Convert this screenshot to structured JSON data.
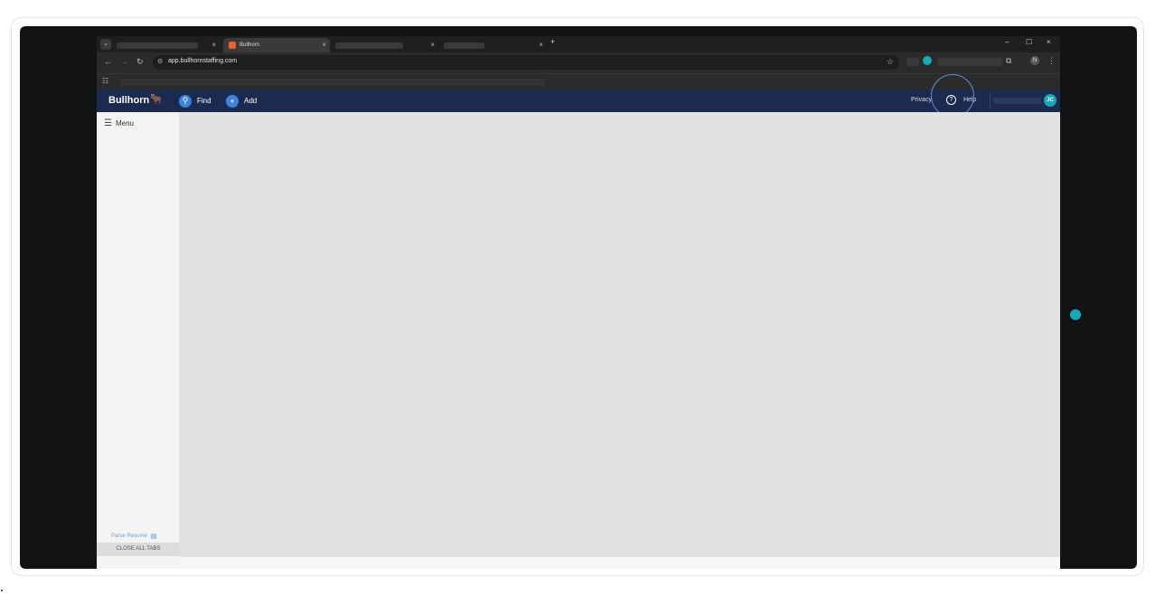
{
  "browser": {
    "tabs": [
      {
        "title": "",
        "close": "×"
      },
      {
        "title": "Bullhorn",
        "close": "×"
      },
      {
        "title": "",
        "close": "×"
      },
      {
        "title": "",
        "close": "×"
      }
    ],
    "tab_search_glyph": "⌄",
    "new_tab": "+",
    "window_controls": {
      "minimize": "–",
      "maximize": "☐",
      "close": "×"
    },
    "nav": {
      "back": "←",
      "forward": "→",
      "reload": "↻"
    },
    "url": "app.bullhornstaffing.com",
    "star": "☆",
    "profile_initial": "N",
    "kebab": "⋮"
  },
  "appbar": {
    "logo": "Bullhorn",
    "find_label": "Find",
    "add_label": "Add",
    "privacy_label": "Privacy",
    "help_label": "Help",
    "avatar_initials": "JC"
  },
  "sidebar": {
    "menu_label": "Menu",
    "parse_resume_label": "Parse Resume",
    "close_all_tabs_label": "CLOSE ALL TABS"
  },
  "colors": {
    "appbar": "#1d2a50",
    "accent_blue": "#3d84d8",
    "avatar_teal": "#1aa6b7",
    "cursor_teal": "#18a9b6",
    "logo_orange": "#ef7a2a"
  },
  "icons": [
    "hamburger-icon",
    "search-icon",
    "plus-icon",
    "help-icon",
    "document-icon",
    "star-icon",
    "bull-logo-icon"
  ]
}
